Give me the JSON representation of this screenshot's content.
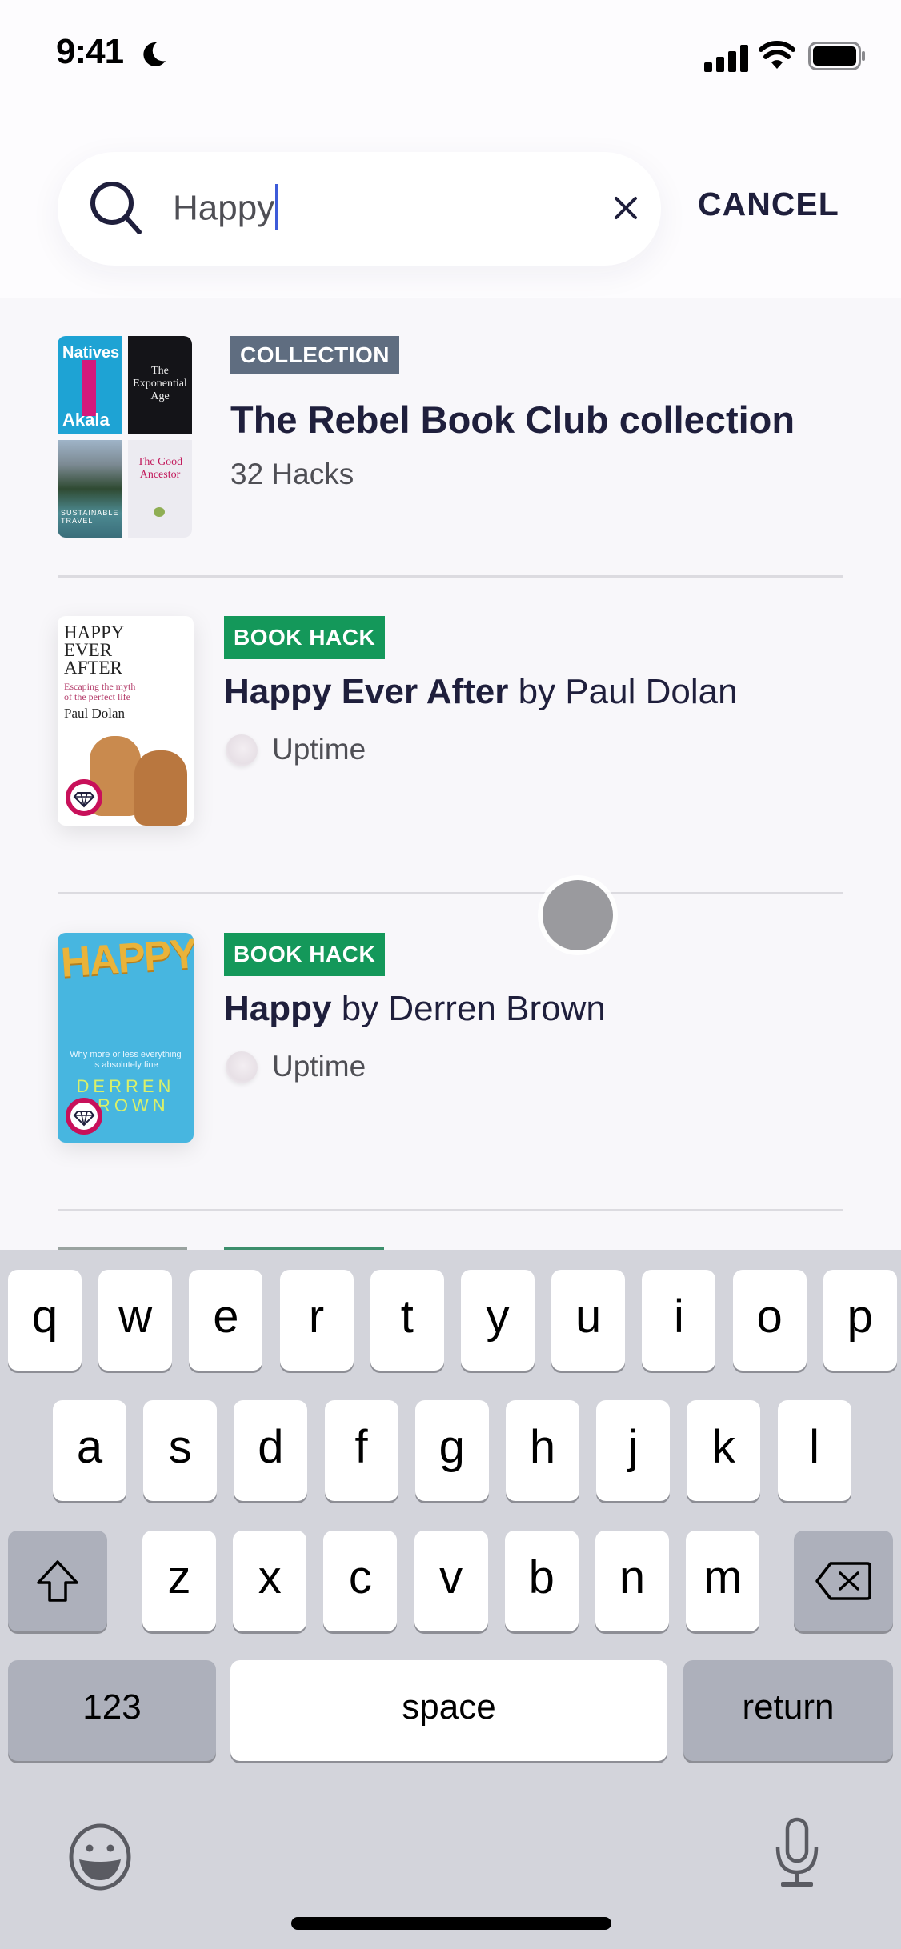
{
  "status_bar": {
    "time": "9:41",
    "focus_icon": "moon-icon",
    "icons": [
      "cellular-signal-icon",
      "wifi-icon",
      "battery-icon"
    ]
  },
  "search": {
    "value": "Happy",
    "clear_icon": "close-icon",
    "cancel_label": "CANCEL"
  },
  "results": [
    {
      "type_label": "COLLECTION",
      "title": "The Rebel Book Club collection",
      "subtitle": "32 Hacks",
      "covers": [
        "Natives – Akala",
        "The Exponential Age",
        "Sustainable Travel",
        "The Good Ancestor"
      ]
    },
    {
      "type_label": "BOOK HACK",
      "title_bold": "Happy Ever After",
      "title_rest": " by Paul Dolan",
      "source": "Uptime",
      "cover": {
        "lines": [
          "HAPPY",
          "EVER",
          "AFTER"
        ],
        "tagline": "Escaping the myth of the perfect life",
        "author": "Paul Dolan"
      }
    },
    {
      "type_label": "BOOK HACK",
      "title_bold": "Happy",
      "title_rest": " by Derren Brown",
      "source": "Uptime",
      "cover": {
        "title": "HAPPY",
        "tagline": "Why more or less everything is absolutely fine",
        "author_lines": [
          "DERREN",
          "BROWN"
        ]
      }
    }
  ],
  "colors": {
    "collection_tag": "#5f6d80",
    "book_hack_tag": "#14985a",
    "title_text": "#1f1f3c",
    "caret": "#3d5bd9",
    "premium_badge_ring": "#c8105a"
  },
  "keyboard": {
    "row1": [
      "q",
      "w",
      "e",
      "r",
      "t",
      "y",
      "u",
      "i",
      "o",
      "p"
    ],
    "row2": [
      "a",
      "s",
      "d",
      "f",
      "g",
      "h",
      "j",
      "k",
      "l"
    ],
    "row3": [
      "z",
      "x",
      "c",
      "v",
      "b",
      "n",
      "m"
    ],
    "numbers_label": "123",
    "space_label": "space",
    "return_label": "return"
  }
}
